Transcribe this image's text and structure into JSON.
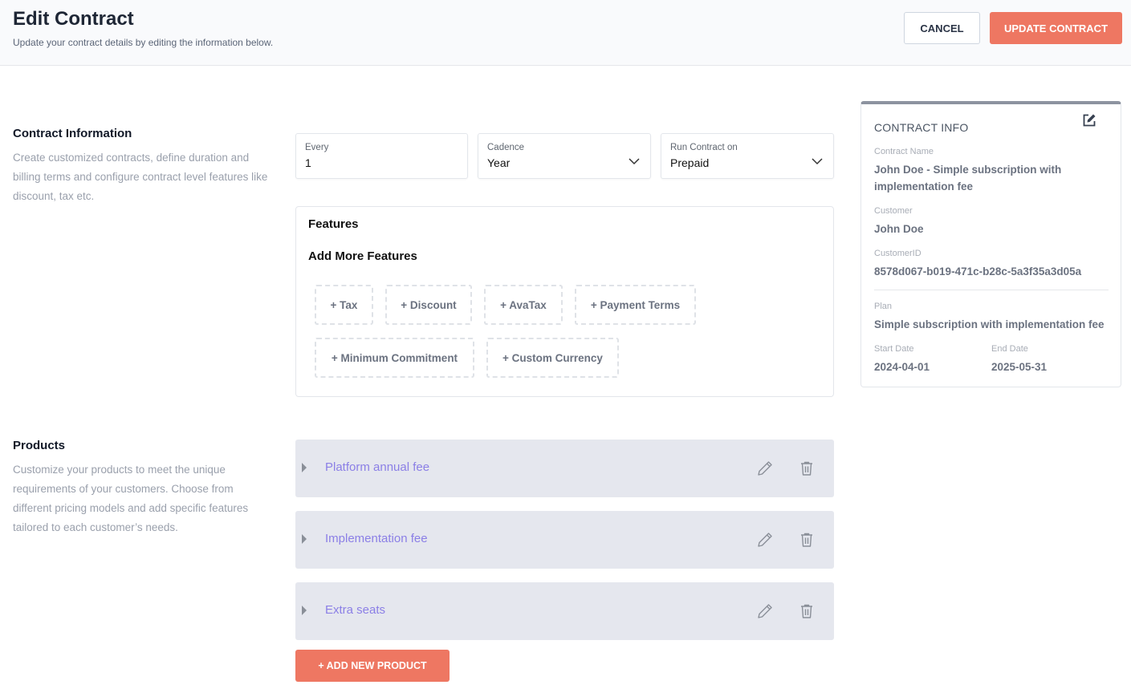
{
  "header": {
    "title": "Edit Contract",
    "subtitle": "Update your contract details by editing the information below.",
    "cancel_label": "CANCEL",
    "update_label": "UPDATE CONTRACT"
  },
  "contract_section": {
    "title": "Contract Information",
    "description": "Create customized contracts, define duration and billing terms and configure contract level features like discount, tax etc.",
    "fields": {
      "every": {
        "label": "Every",
        "value": "1"
      },
      "cadence": {
        "label": "Cadence",
        "value": "Year"
      },
      "run_on": {
        "label": "Run Contract on",
        "value": "Prepaid"
      }
    }
  },
  "features": {
    "title": "Features",
    "add_more_title": "Add More Features",
    "buttons": [
      "+ Tax",
      "+ Discount",
      "+ AvaTax",
      "+ Payment Terms",
      "+ Minimum Commitment",
      "+ Custom Currency"
    ]
  },
  "products_section": {
    "title": "Products",
    "description": "Customize your products to meet the unique requirements of your customers. Choose from different pricing models and add specific features tailored to each customer’s needs.",
    "items": [
      {
        "name": "Platform annual fee"
      },
      {
        "name": "Implementation fee"
      },
      {
        "name": "Extra seats"
      }
    ],
    "add_label": "+ ADD NEW PRODUCT"
  },
  "contract_info": {
    "title": "CONTRACT INFO",
    "contract_name_label": "Contract Name",
    "contract_name": "John Doe - Simple subscription with implementation fee",
    "customer_label": "Customer",
    "customer": "John Doe",
    "customer_id_label": "CustomerID",
    "customer_id": "8578d067-b019-471c-b28c-5a3f35a3d05a",
    "plan_label": "Plan",
    "plan": "Simple subscription with implementation fee",
    "start_date_label": "Start Date",
    "start_date": "2024-04-01",
    "end_date_label": "End Date",
    "end_date": "2025-05-31"
  },
  "colors": {
    "accent": "#ee7762",
    "product_name": "#8b7fe6",
    "product_row_bg": "#e5e7ee"
  }
}
